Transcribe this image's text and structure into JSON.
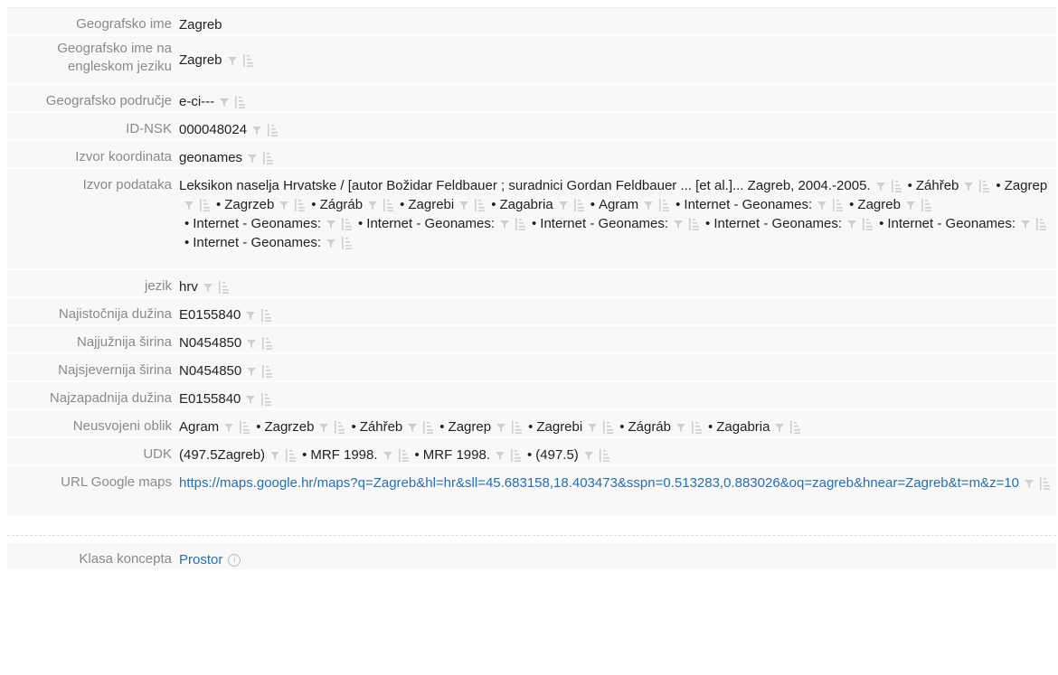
{
  "rows": [
    {
      "label": "Geografsko ime",
      "items": [
        "Zagreb"
      ],
      "icons": false
    },
    {
      "label": "Geografsko ime na engleskom jeziku",
      "items": [
        "Zagreb"
      ],
      "icons": true
    },
    {
      "label": "Geografsko područje",
      "items": [
        "e-ci---"
      ],
      "icons": true
    },
    {
      "label": "ID-NSK",
      "items": [
        "000048024"
      ],
      "icons": true
    },
    {
      "label": "Izvor koordinata",
      "items": [
        "geonames"
      ],
      "icons": true
    },
    {
      "label": "Izvor podataka",
      "items": [
        "Leksikon naselja Hrvatske / [autor Božidar Feldbauer ; suradnici Gordan Feldbauer ... [et al.]... Zagreb, 2004.-2005.",
        "Záhřeb",
        "Zagrep",
        "Zagrzeb",
        "Zágráb",
        "Zagrebi",
        "Zagabria",
        "Agram",
        "Internet - Geonames:",
        "Zagreb",
        "Internet - Geonames:",
        "Internet - Geonames:",
        "Internet - Geonames:",
        "Internet - Geonames:",
        "Internet - Geonames:",
        "Internet - Geonames:"
      ],
      "icons": true
    },
    {
      "label": "jezik",
      "items": [
        "hrv"
      ],
      "icons": true
    },
    {
      "label": "Najistočnija dužina",
      "items": [
        "E0155840"
      ],
      "icons": true
    },
    {
      "label": "Najjužnija širina",
      "items": [
        "N0454850"
      ],
      "icons": true
    },
    {
      "label": "Najsjevernija širina",
      "items": [
        "N0454850"
      ],
      "icons": true
    },
    {
      "label": "Najzapadnija dužina",
      "items": [
        "E0155840"
      ],
      "icons": true
    },
    {
      "label": "Neusvojeni oblik",
      "items": [
        "Agram",
        "Zagrzeb",
        "Záhřeb",
        "Zagrep",
        "Zagrebi",
        "Zágráb",
        "Zagabria"
      ],
      "icons": true
    },
    {
      "label": "UDK",
      "items": [
        "(497.5Zagreb)",
        "MRF 1998.",
        "MRF 1998.",
        "(497.5)"
      ],
      "icons": true
    },
    {
      "label": "URL Google maps",
      "link": "https://maps.google.hr/maps?q=Zagreb&hl=hr&sll=45.683158,18.403473&sspn=0.513283,0.883026&oq=zagreb&hnear=Zagreb&t=m&z=10",
      "icons": true
    }
  ],
  "concept": {
    "label": "Klasa koncepta",
    "value": "Prostor"
  },
  "bullet": "•",
  "icons": {
    "filter": "filter-icon",
    "sort": "sort-icon",
    "info": "info-icon"
  }
}
